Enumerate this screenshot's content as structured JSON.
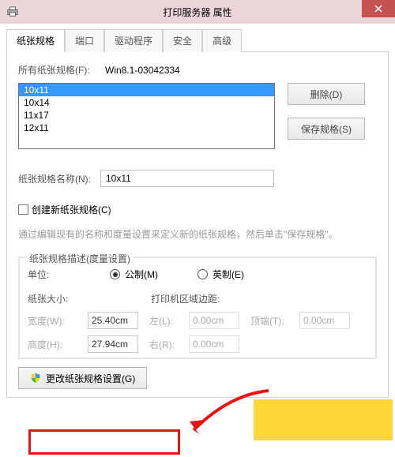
{
  "titlebar": {
    "title": "打印服务器 属性"
  },
  "tabs": [
    "纸张规格",
    "端口",
    "驱动程序",
    "安全",
    "高级"
  ],
  "active_tab": 0,
  "forms_label": "所有纸张规格(F):",
  "server_name": "Win8.1-03042334",
  "listbox_items": [
    "10x11",
    "10x14",
    "11x17",
    "12x11"
  ],
  "selected_item_index": 0,
  "buttons": {
    "delete": "删除(D)",
    "save": "保存规格(S)",
    "change": "更改纸张规格设置(G)"
  },
  "name_label": "纸张规格名称(N):",
  "name_value": "10x11",
  "checkbox_label": "创建新纸张规格(C)",
  "hint_text": "通过编辑现有的名称和度量设置来定义新的纸张规格，然后单击\"保存规格\"。",
  "fieldset_legend": "纸张规格描述(度量设置)",
  "unit_label": "单位:",
  "radio_metric": "公制(M)",
  "radio_imperial": "英制(E)",
  "size_header": "纸张大小:",
  "margin_header": "打印机区域边距:",
  "width_label": "宽度(W):",
  "width_value": "25.40cm",
  "height_label": "高度(H):",
  "height_value": "27.94cm",
  "left_label": "左(L):",
  "left_value": "0.00cm",
  "right_label": "右(R):",
  "right_value": "0.00cm",
  "top_label": "顶端(T):",
  "top_value": "0.00cm"
}
